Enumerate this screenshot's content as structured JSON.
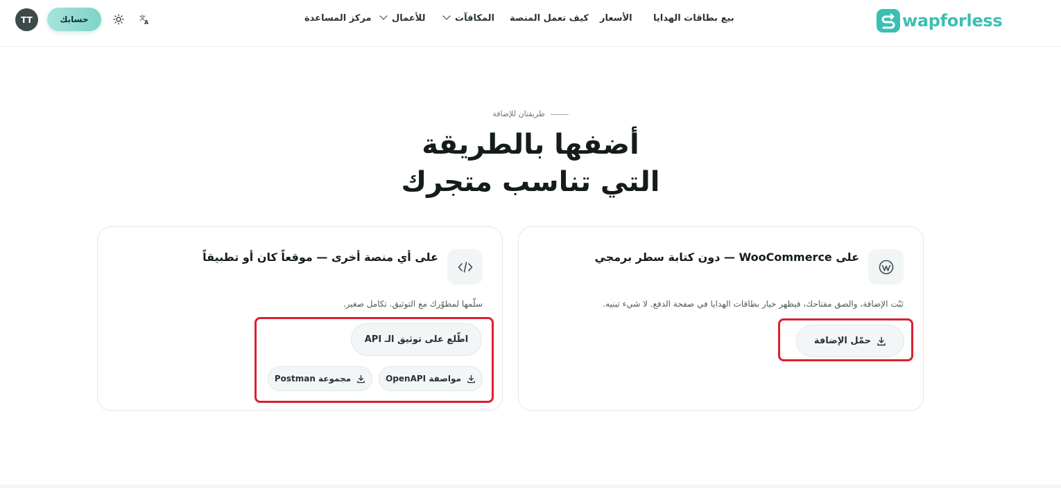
{
  "header": {
    "logo_text": "wapforless",
    "nav": [
      {
        "label": "بيع بطاقات الهدايا",
        "has_dropdown": false
      },
      {
        "label": "الأسعار",
        "has_dropdown": false
      },
      {
        "label": "كيف تعمل المنصة",
        "has_dropdown": false
      },
      {
        "label": "المكافآت",
        "has_dropdown": true
      },
      {
        "label": "للأعمال",
        "has_dropdown": true
      },
      {
        "label": "مركز المساعدة",
        "has_dropdown": false
      }
    ],
    "account_label": "حسابك",
    "avatar_initials": "TT",
    "language_icon": "translate-icon",
    "theme_icon": "sun-icon"
  },
  "hero": {
    "eyebrow": "طريقتان للإضافة",
    "headline_line1": "أضفها بالطريقة",
    "headline_line2": "التي تناسب متجرك"
  },
  "cards": {
    "woocommerce": {
      "icon": "wordpress-icon",
      "title": "على WooCommerce — دون كتابة سطر برمجي",
      "description": "ثبّت الإضافة، والصق مفتاحك، فيظهر خيار بطاقات الهدايا في صفحة الدفع. لا شيء تبنيه.",
      "download_label": "حمّل الإضافة"
    },
    "other_platform": {
      "icon": "code-icon",
      "title": "على أي منصة أخرى — موقعاً كان أو تطبيقاً",
      "description": "سلّمها لمطوّرك مع التوثيق. تكامل صغير.",
      "docs_label": "اطّلع على توثيق الـ API",
      "openapi_label": "مواصفة OpenAPI",
      "postman_label": "مجموعة Postman"
    }
  },
  "colors": {
    "brand": "#3bbfb2",
    "highlight": "#d9202f"
  }
}
